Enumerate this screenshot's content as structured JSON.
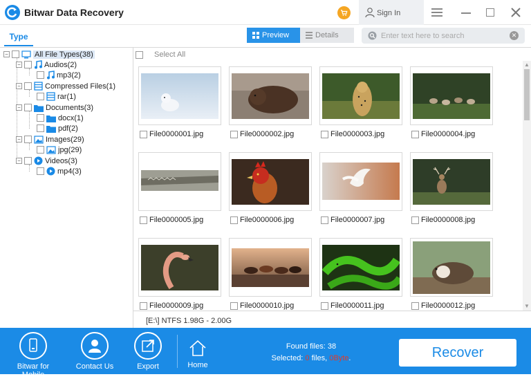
{
  "app": {
    "title": "Bitwar Data Recovery"
  },
  "titlebar": {
    "signin_label": "Sign In"
  },
  "toolbar": {
    "type_tab": "Type",
    "preview_label": "Preview",
    "details_label": "Details",
    "search_placeholder": "Enter text here to search"
  },
  "tree": {
    "root": "All File Types(38)",
    "audios": "Audios(2)",
    "mp3": "mp3(2)",
    "compressed": "Compressed Files(1)",
    "rar": "rar(1)",
    "documents": "Documents(3)",
    "docx": "docx(1)",
    "pdf": "pdf(2)",
    "images": "Images(29)",
    "jpg": "jpg(29)",
    "videos": "Videos(3)",
    "mp4": "mp4(3)"
  },
  "grid": {
    "select_all": "Select All",
    "files": [
      {
        "name": "File0000001.jpg",
        "subject": "arctic-fox"
      },
      {
        "name": "File0000002.jpg",
        "subject": "bear"
      },
      {
        "name": "File0000003.jpg",
        "subject": "cheetah"
      },
      {
        "name": "File0000004.jpg",
        "subject": "deer-herd"
      },
      {
        "name": "File0000005.jpg",
        "subject": "crocodile"
      },
      {
        "name": "File0000006.jpg",
        "subject": "rooster"
      },
      {
        "name": "File0000007.jpg",
        "subject": "dove"
      },
      {
        "name": "File0000008.jpg",
        "subject": "stag"
      },
      {
        "name": "File0000009.jpg",
        "subject": "flamingo"
      },
      {
        "name": "File0000010.jpg",
        "subject": "horses"
      },
      {
        "name": "File0000011.jpg",
        "subject": "green-snake"
      },
      {
        "name": "File0000012.jpg",
        "subject": "guinea-pig"
      }
    ]
  },
  "status": {
    "drive_info": "[E:\\] NTFS 1.98G - 2.00G"
  },
  "bottom": {
    "mobile_label": "Bitwar for Mobile",
    "contact_label": "Contact Us",
    "export_label": "Export",
    "home_label": "Home",
    "found_label": "Found files: 38",
    "selected_prefix": "Selected: ",
    "selected_count": "0",
    "selected_mid": " files, ",
    "selected_size": "0Byte",
    "selected_suffix": ".",
    "recover_label": "Recover"
  },
  "colors": {
    "accent": "#1b8be6",
    "cart": "#f5a623",
    "highlight_red": "#e03a2a"
  }
}
